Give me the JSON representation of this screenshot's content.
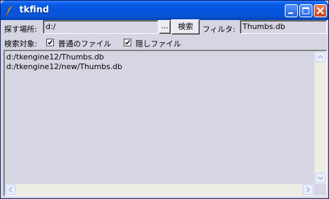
{
  "window": {
    "title": "tkfind",
    "minimize_icon": "minimize-icon",
    "maximize_icon": "maximize-icon",
    "close_icon": "close-icon",
    "app_icon": "feather-icon"
  },
  "search": {
    "location_label": "探す場所:",
    "location_value": "d:/",
    "browse_label": "...",
    "search_button_label": "検索",
    "filter_label": "フィルタ:",
    "filter_value": "Thumbs.db"
  },
  "targets": {
    "label": "検索対象:",
    "normal_files_label": "普通のファイル",
    "normal_files_checked": true,
    "hidden_files_label": "隠しファイル",
    "hidden_files_checked": true
  },
  "results": {
    "items": [
      "d:/tkengine12/Thumbs.db",
      "d:/tkengine12/new/Thumbs.db"
    ]
  },
  "scrollbars": {
    "up_icon": "arrow-up-icon",
    "down_icon": "arrow-down-icon",
    "left_icon": "arrow-left-icon",
    "right_icon": "arrow-right-icon"
  }
}
